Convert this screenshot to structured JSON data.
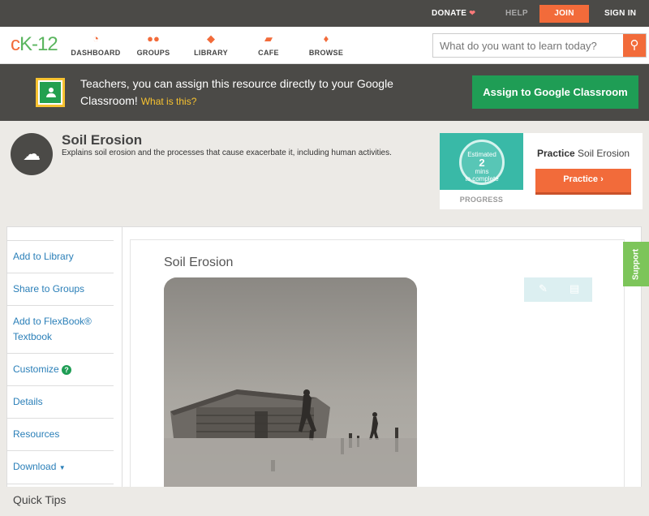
{
  "topbar": {
    "donate": "DONATE",
    "help": "HELP",
    "join": "JOIN",
    "signin": "SIGN IN"
  },
  "nav": {
    "logo_c": "c",
    "logo_rest": "K-12",
    "items": [
      {
        "label": "DASHBOARD",
        "icon": "dashboard-icon"
      },
      {
        "label": "GROUPS",
        "icon": "groups-icon"
      },
      {
        "label": "LIBRARY",
        "icon": "library-icon"
      },
      {
        "label": "CAFE",
        "icon": "cafe-icon"
      },
      {
        "label": "BROWSE",
        "icon": "browse-icon"
      }
    ],
    "search_placeholder": "What do you want to learn today?"
  },
  "banner": {
    "text": "Teachers, you can assign this resource directly to your Google Classroom!",
    "whatis": "What is this?",
    "assign": "Assign to Google Classroom"
  },
  "topic": {
    "title": "Soil Erosion",
    "description": "Explains soil erosion and the processes that cause exacerbate it, including human activities."
  },
  "practice": {
    "progress_estimated": "Estimated",
    "progress_mins": "2",
    "progress_unit": "mins",
    "progress_to": "to complete",
    "progress_label": "PROGRESS",
    "title_bold": "Practice",
    "title_rest": "Soil Erosion",
    "button": "Practice"
  },
  "sidebar": {
    "items": [
      {
        "label": "Add to Library"
      },
      {
        "label": "Share to Groups"
      },
      {
        "label": "Add to FlexBook® Textbook"
      },
      {
        "label": "Customize"
      },
      {
        "label": "Details"
      },
      {
        "label": "Resources"
      },
      {
        "label": "Download"
      }
    ],
    "quick_tips": "Quick Tips"
  },
  "main": {
    "title": "Soil Erosion"
  },
  "support": "Support",
  "colors": {
    "accent": "#f26b3a",
    "green": "#1f9d55",
    "link": "#2a7fb8",
    "dark_bar": "#4b4a47"
  }
}
